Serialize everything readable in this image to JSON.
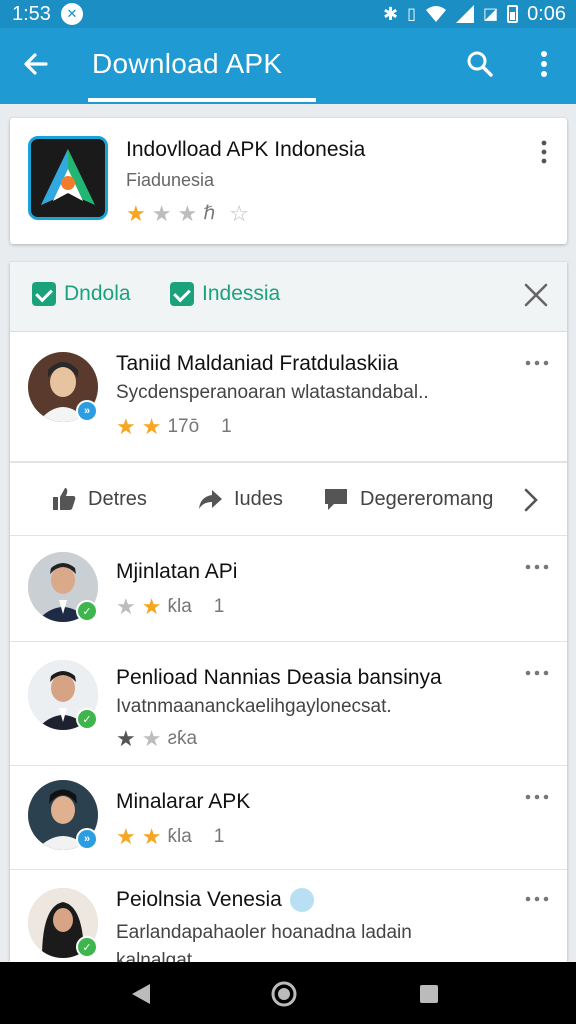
{
  "status_bar": {
    "time_left": "1:53",
    "time_right": "0:06"
  },
  "toolbar": {
    "title": "Download APK"
  },
  "app": {
    "title": "Indovlload APK Indonesia",
    "subtitle": "Fiadunesia",
    "rating_text": "ℏ"
  },
  "filters": [
    {
      "label": "Dndola"
    },
    {
      "label": "Indessia"
    }
  ],
  "reviews": [
    {
      "name": "Taniid Maldaniad Fratdulaskiia",
      "text": "Sycdensperanoaran wlatastandabal..",
      "rating_text": "17ō",
      "count": "1",
      "stars": 2
    },
    {
      "name": "Mjinlatan APi",
      "text": "",
      "rating_text": "ƙla",
      "count": "1",
      "stars": 2
    },
    {
      "name": "Penlioad Nannias Deasia bansinya",
      "text": "Ivatnmaananckaelihgaylonecsat.",
      "rating_text": "ƨƙa",
      "count": "",
      "stars": 1
    },
    {
      "name": "Minalarar APK",
      "text": "",
      "rating_text": "ƙla",
      "count": "1",
      "stars": 2
    },
    {
      "name": "Peiolnsia Venesia",
      "text": "Earlandapahaoler hoanadna ladain",
      "text2": "kalnalgat",
      "rating_text": "",
      "count": "",
      "stars": 0
    }
  ],
  "actions": [
    {
      "label": "Detres",
      "icon": "thumbs-up-icon"
    },
    {
      "label": "Iudes",
      "icon": "share-icon"
    },
    {
      "label": "Degereromang",
      "icon": "comment-icon"
    }
  ],
  "colors": {
    "status": "#1b8fc3",
    "toolbar": "#1f9ad2",
    "accent_green": "#1aa37a",
    "star": "#f5a623"
  }
}
